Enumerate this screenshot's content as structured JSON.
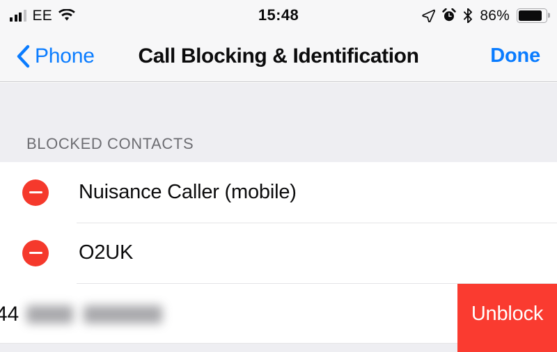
{
  "status_bar": {
    "carrier": "EE",
    "signal_icon": "signal-bars-icon",
    "wifi_icon": "wifi-icon",
    "time": "15:48",
    "location_icon": "location-arrow-icon",
    "alarm_icon": "alarm-clock-icon",
    "bluetooth_icon": "bluetooth-icon",
    "battery_percent": "86%",
    "battery_icon": "battery-icon",
    "battery_level": 86
  },
  "nav_bar": {
    "back_icon": "chevron-left-icon",
    "back_label": "Phone",
    "title": "Call Blocking & Identification",
    "done_label": "Done"
  },
  "section": {
    "header": "BLOCKED CONTACTS"
  },
  "blocked_contacts": [
    {
      "delete_icon": "minus-circle-icon",
      "name": "Nuisance Caller (mobile)"
    },
    {
      "delete_icon": "minus-circle-icon",
      "name": "O2UK"
    }
  ],
  "swiped_row": {
    "visible_prefix": "44",
    "name": "",
    "redacted": true,
    "action_label": "Unblock"
  },
  "colors": {
    "accent_blue": "#0a7cff",
    "destructive_red": "#fa3b30",
    "minus_red": "#f5392c",
    "bar_background": "#f7f7f8",
    "group_background": "#eeeef2",
    "separator": "#e4e4e6",
    "secondary_text": "#6d6d72",
    "primary_text": "#0b0b0c"
  }
}
